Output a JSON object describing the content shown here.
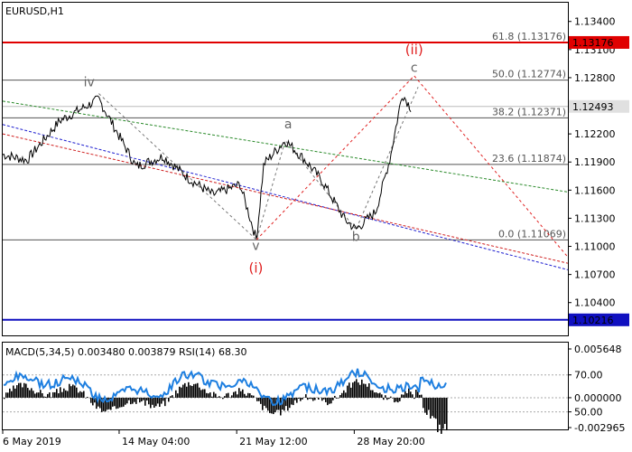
{
  "chart_data": {
    "type": "line",
    "symbol": "EURUSD,H1",
    "title": "",
    "y_range": [
      1.1005,
      1.136
    ],
    "y_ticks": [
      "1.13400",
      "1.13100",
      "1.12800",
      "1.12500",
      "1.12200",
      "1.11900",
      "1.11600",
      "1.11300",
      "1.11000",
      "1.10700",
      "1.10400"
    ],
    "x_ticks": [
      "6 May 2019",
      "14 May 04:00",
      "21 May 12:00",
      "28 May 20:00"
    ],
    "current_price": "1.12493",
    "fib_levels": [
      {
        "label": "61.8 (1.13176)",
        "value": 1.13176
      },
      {
        "label": "50.0 (1.12774)",
        "value": 1.12774
      },
      {
        "label": "38.2 (1.12371)",
        "value": 1.12371
      },
      {
        "label": "23.6 (1.11874)",
        "value": 1.11874
      },
      {
        "label": "0.0 (1.11069)",
        "value": 1.11069
      }
    ],
    "resistance": {
      "label": "1.13176",
      "value": 1.13176,
      "color": "#e00000"
    },
    "support": {
      "label": "1.10216",
      "value": 1.10216,
      "color": "#1010c0"
    },
    "wave_labels": [
      {
        "text": "iv",
        "x": 0.153,
        "value": 1.1271,
        "color": "#666666"
      },
      {
        "text": "a",
        "x": 0.505,
        "value": 1.1226,
        "color": "#666666"
      },
      {
        "text": "v",
        "x": 0.448,
        "value": 1.1096,
        "color": "#666666"
      },
      {
        "text": "(i)",
        "x": 0.448,
        "value": 1.1072,
        "color": "#e02020"
      },
      {
        "text": "b",
        "x": 0.625,
        "value": 1.1106,
        "color": "#666666"
      },
      {
        "text": "(ii)",
        "x": 0.728,
        "value": 1.1305,
        "color": "#e02020"
      },
      {
        "text": "c",
        "x": 0.728,
        "value": 1.1286,
        "color": "#666666"
      }
    ],
    "pivots": [
      {
        "x": 0.0,
        "value": 1.1198
      },
      {
        "x": 0.043,
        "value": 1.1192
      },
      {
        "x": 0.101,
        "value": 1.1234
      },
      {
        "x": 0.17,
        "value": 1.1257
      },
      {
        "x": 0.236,
        "value": 1.1185
      },
      {
        "x": 0.284,
        "value": 1.1196
      },
      {
        "x": 0.33,
        "value": 1.1172
      },
      {
        "x": 0.372,
        "value": 1.1155
      },
      {
        "x": 0.42,
        "value": 1.1166
      },
      {
        "x": 0.449,
        "value": 1.1107
      },
      {
        "x": 0.462,
        "value": 1.1188
      },
      {
        "x": 0.5,
        "value": 1.1213
      },
      {
        "x": 0.535,
        "value": 1.1192
      },
      {
        "x": 0.565,
        "value": 1.117
      },
      {
        "x": 0.605,
        "value": 1.1129
      },
      {
        "x": 0.625,
        "value": 1.1118
      },
      {
        "x": 0.66,
        "value": 1.1137
      },
      {
        "x": 0.685,
        "value": 1.1193
      },
      {
        "x": 0.707,
        "value": 1.1263
      },
      {
        "x": 0.722,
        "value": 1.1248
      }
    ],
    "indicator": {
      "label": "MACD(5,34,5) 0.003480 0.003879 RSI(14) 68.30",
      "y_ticks": [
        "0.005648",
        "70.00",
        "0.000000",
        "50.00",
        "-0.002965"
      ]
    }
  }
}
